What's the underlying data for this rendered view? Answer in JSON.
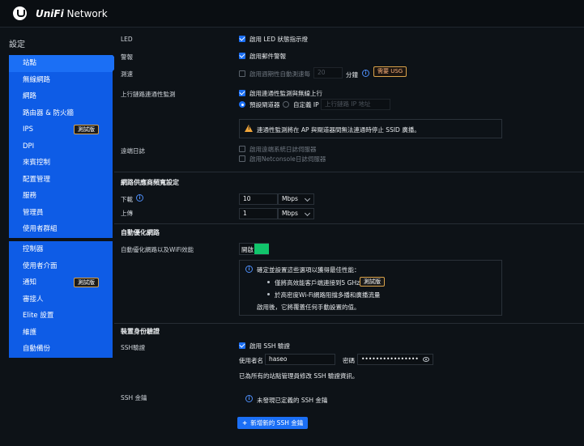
{
  "header": {
    "brand_prefix": "UniFi",
    "brand_suffix": " Network"
  },
  "sidebar": {
    "title": "設定",
    "group1": [
      {
        "label": "站點",
        "active": true
      },
      {
        "label": "無線網路"
      },
      {
        "label": "網路"
      },
      {
        "label": "路由器 & 防火牆"
      },
      {
        "label": "IPS",
        "badge": "測試版"
      },
      {
        "label": "DPI"
      },
      {
        "label": "來賓控制"
      },
      {
        "label": "配置管理"
      },
      {
        "label": "服務"
      },
      {
        "label": "管理員"
      },
      {
        "label": "使用者群組"
      }
    ],
    "group2": [
      {
        "label": "控制器"
      },
      {
        "label": "使用者介面"
      },
      {
        "label": "通知",
        "badge": "測試版"
      },
      {
        "label": "審接人"
      },
      {
        "label": "Elite 設置"
      },
      {
        "label": "維護"
      },
      {
        "label": "自動備份"
      }
    ]
  },
  "led": {
    "label": "LED",
    "checkbox": "啟用 LED 狀態指示燈"
  },
  "alerts": {
    "label": "警報",
    "checkbox": "啟用郵件警報"
  },
  "speedtest": {
    "label": "測速",
    "checkbox": "啟用週期性自動測速每",
    "value": "20",
    "unit": "分鐘",
    "badge": "需要 USG"
  },
  "uplink": {
    "label": "上行鏈路連通性監測",
    "checkbox": "啟用連通性監測與無線上行",
    "radio_default": "預設閘道器",
    "radio_custom": "自定義 IP",
    "ip_placeholder": "上行鏈路 IP 地址",
    "warning": "連通性監測將在 AP 與閘道器間無法連通時停止 SSID 廣播。"
  },
  "remote_log": {
    "label": "遠端日誌",
    "option1": "啟用遠端系統日誌伺服器",
    "option2": "啟用Netconsole日誌伺服器"
  },
  "isp": {
    "title": "網路供應商頻寬設定",
    "download_label": "下載",
    "download_value": "10",
    "download_unit": "Mbps",
    "upload_label": "上傳",
    "upload_value": "1",
    "upload_unit": "Mbps"
  },
  "auto_opt": {
    "title": "自動優化網路",
    "label": "自動優化網路以及WiFi效能",
    "toggle": "開啟",
    "toggle_on": true,
    "info_title": "確定並設置這些選項以獲得最佳性能：",
    "item1": "僅將高效能客戶端連接到5 GHz",
    "item1_badge": "測試版",
    "item2": "於高密度Wi-Fi網路阻擋多播和廣播流量",
    "info_footer": "啟用後，它將覆蓋任何手動設置的值。"
  },
  "device_auth": {
    "title": "裝置身份驗證",
    "ssh_label": "SSH驗證",
    "ssh_checkbox": "啟用 SSH 驗證",
    "username_label": "使用者名",
    "username_value": "haseo",
    "password_label": "密碼",
    "password_value": "••••••••••••••••",
    "note": "已為所有的站點管理員修改 SSH 驗證資訊。",
    "keys_label": "SSH 金鑰",
    "keys_info": "未發現已定義的 SSH 金鑰",
    "add_key_button": "新增新的 SSH 金鑰"
  },
  "colors": {
    "accent": "#1b6ff5",
    "sidebar": "#0e5ce6",
    "toggle_on": "#11c46b",
    "badge_border": "#d9a24a"
  }
}
